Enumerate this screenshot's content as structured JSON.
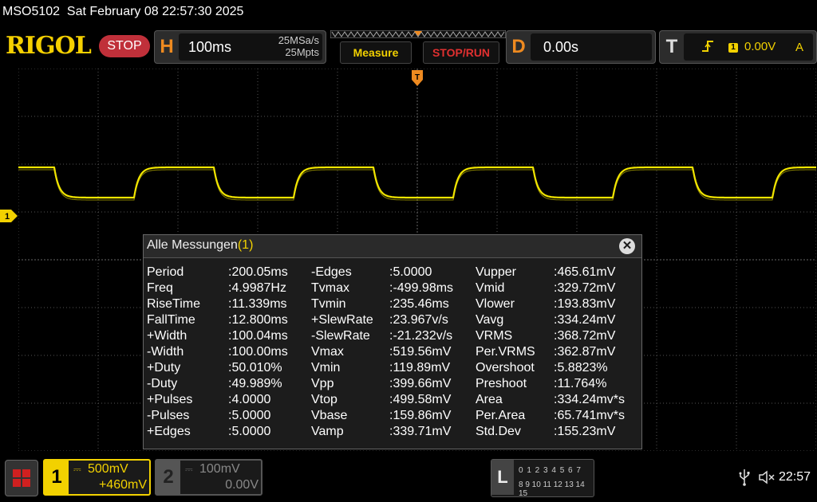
{
  "status_bar": {
    "text": "MSO5102  Sat February 08 22:57:30 2025"
  },
  "top_bar": {
    "logo": "RIGOL",
    "run_state": "STOP",
    "horizontal": {
      "letter": "H",
      "timebase": "100ms",
      "sample_rate": "25MSa/s",
      "memory_depth": "25Mpts"
    },
    "measure_button": "Measure",
    "stop_run_button": "STOP/RUN",
    "delay": {
      "letter": "D",
      "value": "0.00s"
    },
    "trigger": {
      "letter": "T",
      "channel": "1",
      "level": "0.00V",
      "mode": "A"
    }
  },
  "waveform": {
    "channel": "1",
    "color": "#f2e600",
    "shape": "square-rc",
    "period_ms": 200.05,
    "high_mv": 465.61,
    "low_mv": 193.83
  },
  "markers": {
    "ch1_ground": "1",
    "trigger_pos": "T"
  },
  "measurements": {
    "title": "Alle Messungen",
    "title_channel": "(1)",
    "close_icon": "close-icon",
    "columns": [
      [
        {
          "name": "Period",
          "value": ":200.05ms"
        },
        {
          "name": "Freq",
          "value": ":4.9987Hz"
        },
        {
          "name": "RiseTime",
          "value": ":11.339ms"
        },
        {
          "name": "FallTime",
          "value": ":12.800ms"
        },
        {
          "name": "+Width",
          "value": ":100.04ms"
        },
        {
          "name": "-Width",
          "value": ":100.00ms"
        },
        {
          "name": "+Duty",
          "value": ":50.010%"
        },
        {
          "name": "-Duty",
          "value": ":49.989%"
        },
        {
          "name": "+Pulses",
          "value": ":4.0000"
        },
        {
          "name": "-Pulses",
          "value": ":5.0000"
        },
        {
          "name": "+Edges",
          "value": ":5.0000"
        }
      ],
      [
        {
          "name": "-Edges",
          "value": ":5.0000"
        },
        {
          "name": "Tvmax",
          "value": ":-499.98ms"
        },
        {
          "name": "Tvmin",
          "value": ":235.46ms"
        },
        {
          "name": "+SlewRate",
          "value": ":23.967v/s"
        },
        {
          "name": "-SlewRate",
          "value": ":-21.232v/s"
        },
        {
          "name": "Vmax",
          "value": ":519.56mV"
        },
        {
          "name": "Vmin",
          "value": ":119.89mV"
        },
        {
          "name": "Vpp",
          "value": ":399.66mV"
        },
        {
          "name": "Vtop",
          "value": ":499.58mV"
        },
        {
          "name": "Vbase",
          "value": ":159.86mV"
        },
        {
          "name": "Vamp",
          "value": ":339.71mV"
        }
      ],
      [
        {
          "name": "Vupper",
          "value": ":465.61mV"
        },
        {
          "name": "Vmid",
          "value": ":329.72mV"
        },
        {
          "name": "Vlower",
          "value": ":193.83mV"
        },
        {
          "name": "Vavg",
          "value": ":334.24mV"
        },
        {
          "name": "VRMS",
          "value": ":368.72mV"
        },
        {
          "name": "Per.VRMS",
          "value": ":362.87mV"
        },
        {
          "name": "Overshoot",
          "value": ":5.8823%"
        },
        {
          "name": "Preshoot",
          "value": ":11.764%"
        },
        {
          "name": "Area",
          "value": ":334.24mv*s"
        },
        {
          "name": "Per.Area",
          "value": ":65.741mv*s"
        },
        {
          "name": "Std.Dev",
          "value": ":155.23mV"
        }
      ]
    ]
  },
  "bottom_bar": {
    "ch1": {
      "number": "1",
      "scale": "500mV",
      "offset": "+460mV"
    },
    "ch2": {
      "number": "2",
      "scale": "100mV",
      "offset": "0.00V"
    },
    "la": {
      "letter": "L",
      "row1": "0 1 2 3  4 5 6 7",
      "row2": "8 9 10 11 12 13 14 15"
    },
    "clock": "22:57"
  },
  "colors": {
    "accent": "#f2d100",
    "stop": "#c0303a",
    "orange": "#ee8a20"
  }
}
